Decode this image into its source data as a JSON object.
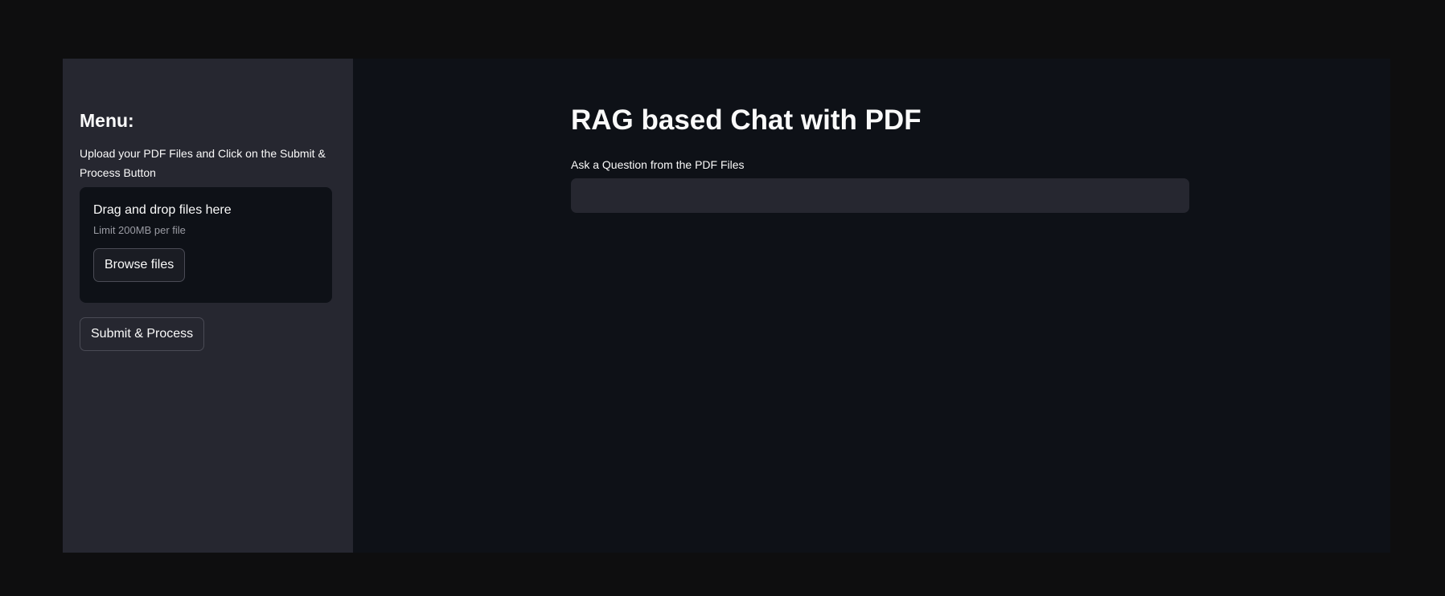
{
  "sidebar": {
    "title": "Menu:",
    "instructions": "Upload your PDF Files and Click on the Submit & Process Button",
    "uploader": {
      "title": "Drag and drop files here",
      "limit": "Limit 200MB per file",
      "browse_label": "Browse files"
    },
    "submit_label": "Submit & Process"
  },
  "main": {
    "title": "RAG based Chat with PDF",
    "question_label": "Ask a Question from the PDF Files",
    "question_value": "",
    "question_placeholder": ""
  },
  "colors": {
    "page_background": "#0e0e0f",
    "app_background": "#0e1117",
    "sidebar_background": "#262730",
    "input_background": "#262730",
    "text": "#fafafa",
    "muted_text": "#9a9ba3"
  }
}
